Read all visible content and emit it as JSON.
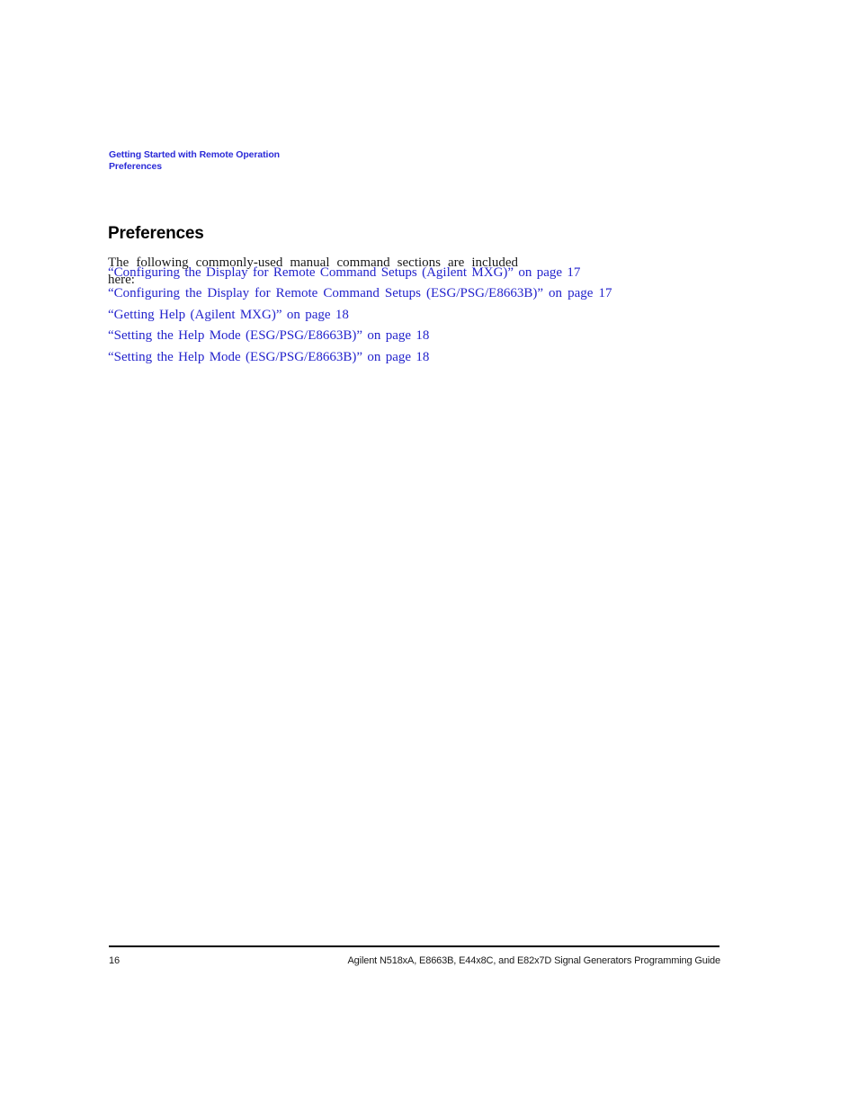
{
  "running_header": {
    "line1": "Getting Started with Remote Operation",
    "line2": "Preferences",
    "color": "#2b2bd8"
  },
  "section": {
    "heading": "Preferences",
    "intro": "The following commonly-used manual command sections are included here:"
  },
  "cross_references": [
    {
      "text": "“Configuring the Display for Remote Command Setups (Agilent MXG)” on page 17"
    },
    {
      "text": "“Configuring the Display for Remote Command Setups (ESG/PSG/E8663B)” on page 17"
    },
    {
      "text": "“Getting Help (Agilent MXG)” on page 18"
    },
    {
      "text": "“Setting the Help Mode (ESG/PSG/E8663B)” on page 18"
    },
    {
      "text": "“Setting the Help Mode (ESG/PSG/E8663B)” on page 18"
    }
  ],
  "link_color": "#2323cc",
  "footer": {
    "page_number": "16",
    "guide_title": "Agilent N518xA, E8663B, E44x8C, and E82x7D Signal Generators Programming Guide"
  }
}
